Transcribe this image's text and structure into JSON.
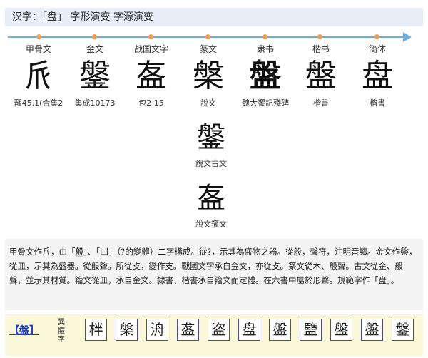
{
  "header": {
    "title": "汉字：「盘」 字形演变 字源演变"
  },
  "stages": [
    {
      "era": "甲骨文",
      "glyph": "𠂢",
      "source": "戬45.1(合集2"
    },
    {
      "era": "金文",
      "glyph": "鎜",
      "source": "集成10173"
    },
    {
      "era": "战国文字",
      "glyph": "𥁊",
      "source": "包2·15"
    },
    {
      "era": "篆文",
      "glyph": "槃",
      "source": "說文"
    },
    {
      "era": "隶书",
      "glyph": "盤",
      "source": "魏大饗記殘碑"
    },
    {
      "era": "楷书",
      "glyph": "盤",
      "source": "楷書"
    },
    {
      "era": "简体",
      "glyph": "盘",
      "source": "楷書"
    }
  ],
  "variants": [
    {
      "glyph": "鎜",
      "source": "說文古文"
    },
    {
      "glyph": "𥁊",
      "source": "說文籀文"
    }
  ],
  "description": {
    "p1": "甲骨文作",
    "p1_glyph": "𠂢",
    "p2": "，由「",
    "p2_hl": "般",
    "p3": "」、「",
    "p3_glyph": "凵",
    "p4": "」（?的變體）二字構成。從?，示其為盛物之器。從般，聲符，注明音讀。金文作",
    "p4_glyph": "鎜",
    "p5": "，從皿，示其為盛器。從般聲。所從攴，變作支。戰國文字承自金文，亦從攴。篆文從木、般聲。古文從金、般聲，並示其材質。籀文從皿，承自金文。隸書、楷書承自籀文而定體。在六書中屬於形聲。規範字作「盘」。"
  },
  "bottom": {
    "main_label": "【盤】",
    "variant_label": "異體字",
    "variants": [
      "柈",
      "槃",
      "洀",
      "盋",
      "盗",
      "盘",
      "盤",
      "盬",
      "盤",
      "盤",
      "鎜"
    ]
  }
}
